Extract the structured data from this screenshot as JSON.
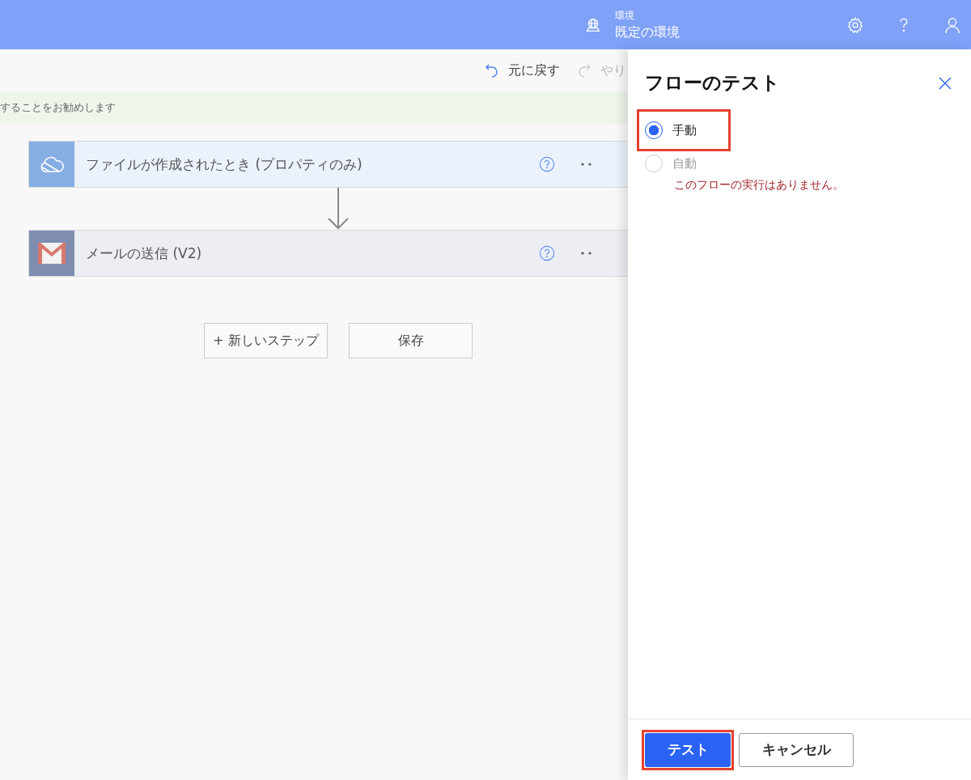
{
  "header": {
    "environment_label": "環境",
    "environment_name": "既定の環境"
  },
  "toolbar": {
    "undo": "元に戻す",
    "redo": "やり"
  },
  "banner": {
    "text": "することをお勧めします"
  },
  "steps": [
    {
      "title": "ファイルが作成されたとき (プロパティのみ)",
      "kind": "cloud",
      "color": "#87aee4"
    },
    {
      "title": "メールの送信 (V2)",
      "kind": "mail",
      "color": "#7f8db1"
    }
  ],
  "canvas_buttons": {
    "new_step": "+ 新しいステップ",
    "save": "保存"
  },
  "panel": {
    "title": "フローのテスト",
    "options": [
      {
        "label": "手動",
        "selected": true,
        "disabled": false,
        "highlighted": true
      },
      {
        "label": "自動",
        "selected": false,
        "disabled": true,
        "highlighted": false
      }
    ],
    "error": "このフローの実行はありません。",
    "buttons": [
      {
        "label": "テスト",
        "kind": "primary",
        "highlighted": true
      },
      {
        "label": "キャンセル",
        "kind": "secondary",
        "highlighted": false
      }
    ]
  }
}
